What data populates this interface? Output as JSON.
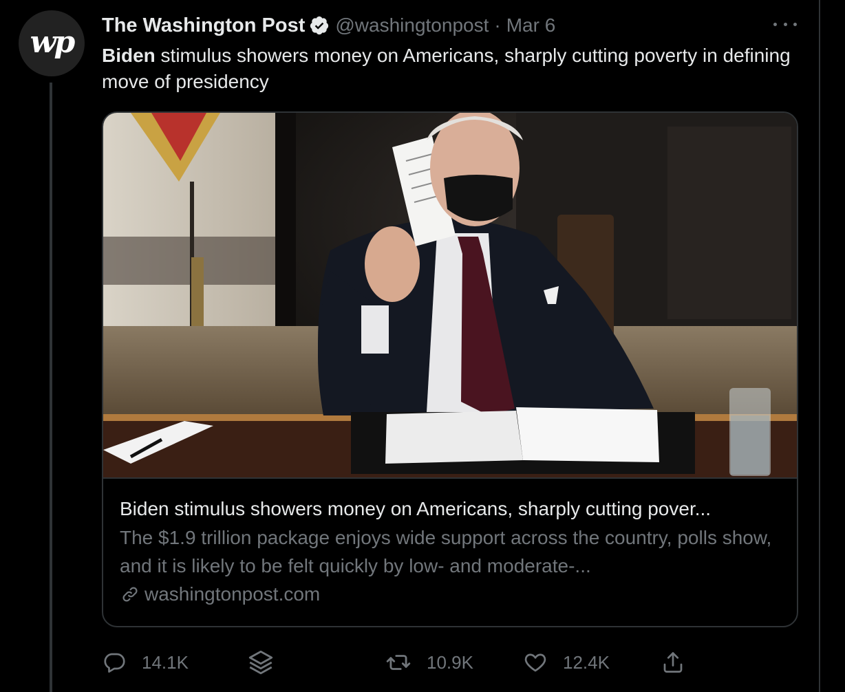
{
  "tweet": {
    "avatar_text": "wp",
    "author_name": "The Washington Post",
    "handle": "@washingtonpost",
    "separator": "·",
    "date": "Mar 6",
    "text_bold": "Biden",
    "text_rest": " stimulus showers money on Americans, sharply cutting poverty in defining move of presidency"
  },
  "card": {
    "title": "Biden stimulus showers money on Americans, sharply cutting pover...",
    "description": "The $1.9 trillion package enjoys wide support across the country, polls show, and it is likely to be felt quickly by low- and moderate-...",
    "domain": "washingtonpost.com",
    "image_alt": "Biden holding a card at a desk in a mask"
  },
  "actions": {
    "replies": "14.1K",
    "retweets": "10.9K",
    "likes": "12.4K"
  },
  "icons": {
    "verified": "verified-badge-icon",
    "more": "more-icon",
    "reply": "reply-icon",
    "stack": "stack-icon",
    "retweet": "retweet-icon",
    "like": "heart-icon",
    "share": "share-icon",
    "link": "link-icon"
  },
  "colors": {
    "background": "#000000",
    "text": "#e7e9ea",
    "secondary": "#71767b",
    "border": "#2f3336"
  }
}
